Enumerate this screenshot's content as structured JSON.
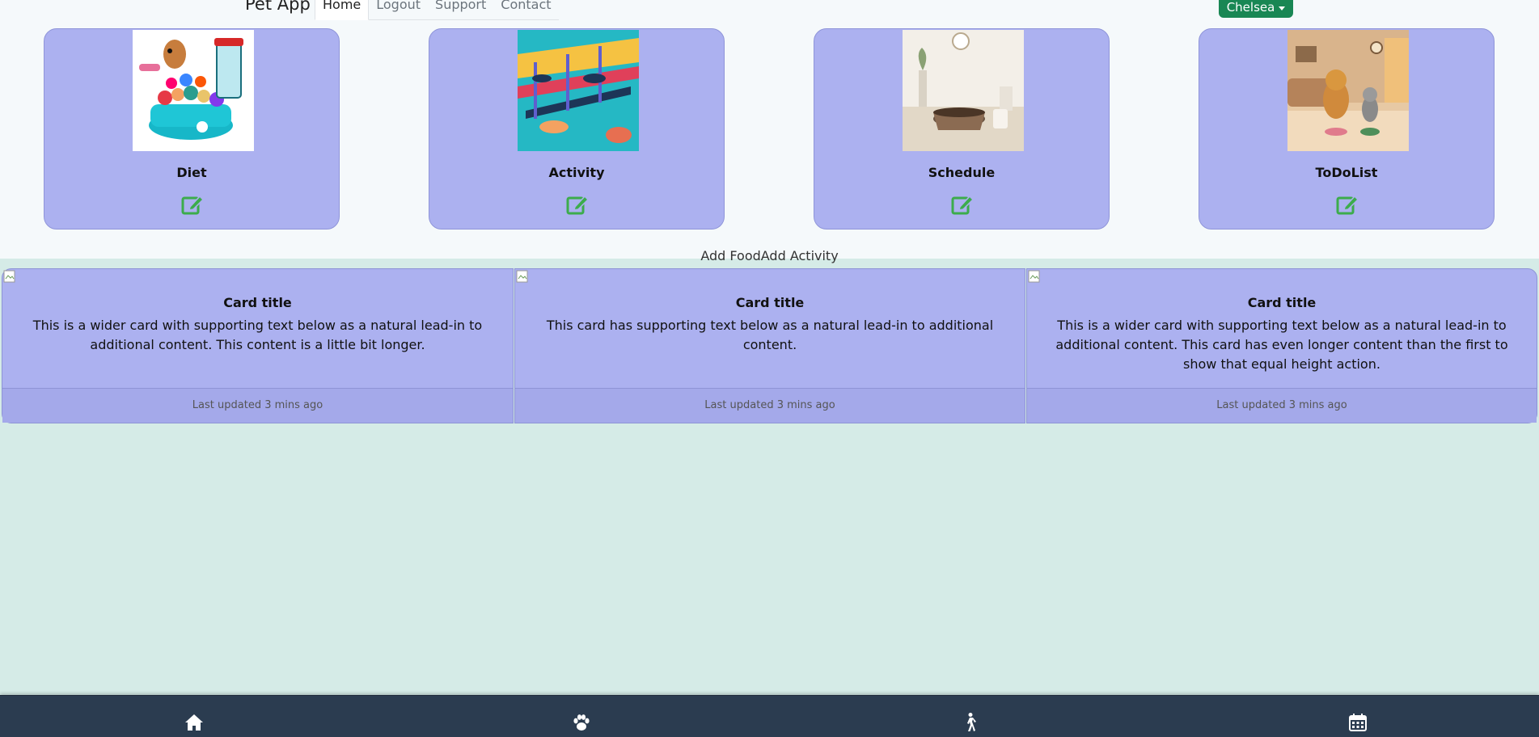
{
  "nav": {
    "brand": "Pet App",
    "links": [
      "Home",
      "Logout",
      "Support",
      "Contact"
    ],
    "user": "Chelsea"
  },
  "features": [
    {
      "title": "Diet",
      "icon": "edit-icon"
    },
    {
      "title": "Activity",
      "icon": "edit-icon"
    },
    {
      "title": "Schedule",
      "icon": "edit-icon"
    },
    {
      "title": "ToDoList",
      "icon": "edit-icon"
    }
  ],
  "actions": {
    "add_food": "Add Food",
    "add_activity": "Add Activity"
  },
  "cards": [
    {
      "title": "Card title",
      "text": "This is a wider card with supporting text below as a natural lead-in to additional content. This content is a little bit longer.",
      "footer": "Last updated 3 mins ago"
    },
    {
      "title": "Card title",
      "text": "This card has supporting text below as a natural lead-in to additional content.",
      "footer": "Last updated 3 mins ago"
    },
    {
      "title": "Card title",
      "text": "This is a wider card with supporting text below as a natural lead-in to additional content. This card has even longer content than the first to show that equal height action.",
      "footer": "Last updated 3 mins ago"
    }
  ],
  "bottom_nav": [
    "home-icon",
    "paw-icon",
    "walking-icon",
    "calendar-icon"
  ],
  "colors": {
    "card": "#acb1f0",
    "accent": "#198754",
    "edit_icon": "#3cac4c",
    "bottom_bar": "#2b3c50",
    "page_bg": "#d5ebe7"
  }
}
